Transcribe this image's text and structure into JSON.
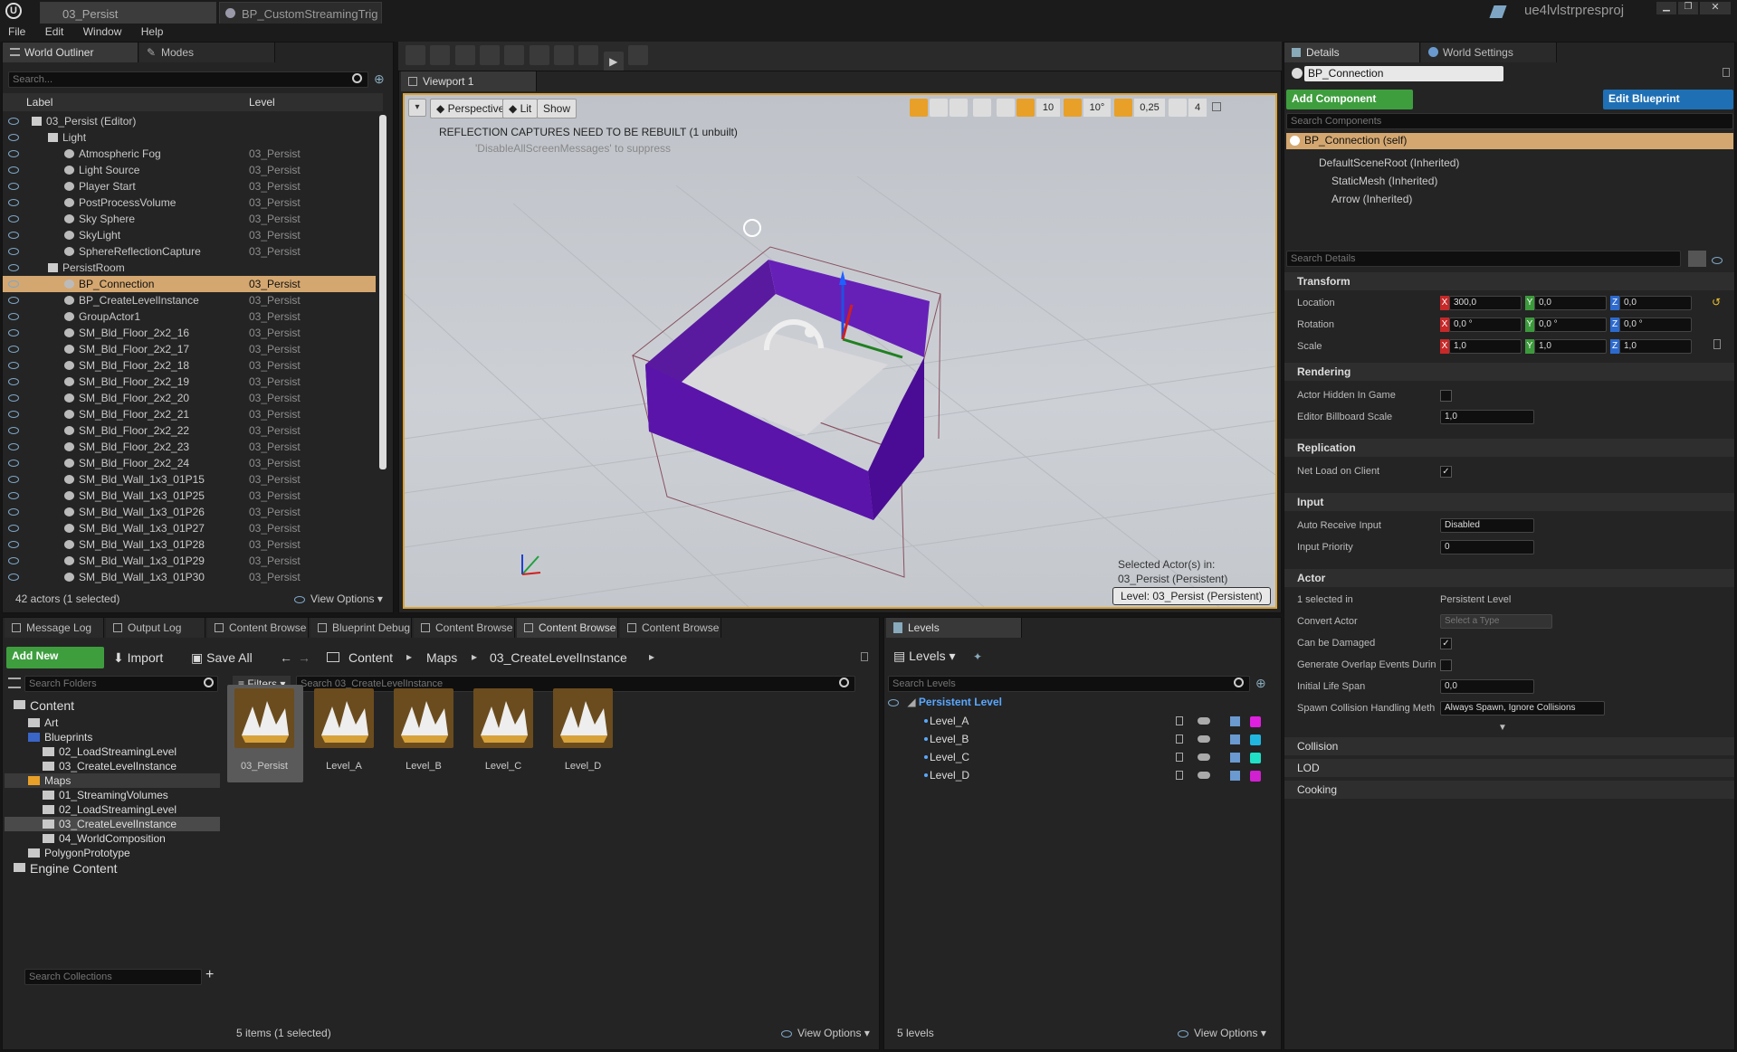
{
  "app": {
    "document_tabs": [
      "03_Persist",
      "BP_CustomStreamingTrig"
    ],
    "project": "ue4lvlstrpresproj"
  },
  "menu": [
    "File",
    "Edit",
    "Window",
    "Help"
  ],
  "outliner": {
    "tabs": [
      "World Outliner",
      "Modes"
    ],
    "search_placeholder": "Search...",
    "col_label": "Label",
    "col_level": "Level",
    "rows": [
      {
        "label": "03_Persist (Editor)",
        "level": "",
        "indent": 0
      },
      {
        "label": "Light",
        "level": "",
        "indent": 1
      },
      {
        "label": "Atmospheric Fog",
        "level": "03_Persist",
        "indent": 2
      },
      {
        "label": "Light Source",
        "level": "03_Persist",
        "indent": 2
      },
      {
        "label": "Player Start",
        "level": "03_Persist",
        "indent": 2
      },
      {
        "label": "PostProcessVolume",
        "level": "03_Persist",
        "indent": 2
      },
      {
        "label": "Sky Sphere",
        "level": "03_Persist",
        "indent": 2
      },
      {
        "label": "SkyLight",
        "level": "03_Persist",
        "indent": 2
      },
      {
        "label": "SphereReflectionCapture",
        "level": "03_Persist",
        "indent": 2
      },
      {
        "label": "PersistRoom",
        "level": "",
        "indent": 1
      },
      {
        "label": "BP_Connection",
        "level": "03_Persist",
        "indent": 2,
        "selected": true
      },
      {
        "label": "BP_CreateLevelInstance",
        "level": "03_Persist",
        "indent": 2
      },
      {
        "label": "GroupActor1",
        "level": "03_Persist",
        "indent": 2
      },
      {
        "label": "SM_Bld_Floor_2x2_16",
        "level": "03_Persist",
        "indent": 2
      },
      {
        "label": "SM_Bld_Floor_2x2_17",
        "level": "03_Persist",
        "indent": 2
      },
      {
        "label": "SM_Bld_Floor_2x2_18",
        "level": "03_Persist",
        "indent": 2
      },
      {
        "label": "SM_Bld_Floor_2x2_19",
        "level": "03_Persist",
        "indent": 2
      },
      {
        "label": "SM_Bld_Floor_2x2_20",
        "level": "03_Persist",
        "indent": 2
      },
      {
        "label": "SM_Bld_Floor_2x2_21",
        "level": "03_Persist",
        "indent": 2
      },
      {
        "label": "SM_Bld_Floor_2x2_22",
        "level": "03_Persist",
        "indent": 2
      },
      {
        "label": "SM_Bld_Floor_2x2_23",
        "level": "03_Persist",
        "indent": 2
      },
      {
        "label": "SM_Bld_Floor_2x2_24",
        "level": "03_Persist",
        "indent": 2
      },
      {
        "label": "SM_Bld_Wall_1x3_01P15",
        "level": "03_Persist",
        "indent": 2
      },
      {
        "label": "SM_Bld_Wall_1x3_01P25",
        "level": "03_Persist",
        "indent": 2
      },
      {
        "label": "SM_Bld_Wall_1x3_01P26",
        "level": "03_Persist",
        "indent": 2
      },
      {
        "label": "SM_Bld_Wall_1x3_01P27",
        "level": "03_Persist",
        "indent": 2
      },
      {
        "label": "SM_Bld_Wall_1x3_01P28",
        "level": "03_Persist",
        "indent": 2
      },
      {
        "label": "SM_Bld_Wall_1x3_01P29",
        "level": "03_Persist",
        "indent": 2
      },
      {
        "label": "SM_Bld_Wall_1x3_01P30",
        "level": "03_Persist",
        "indent": 2
      }
    ],
    "status": "42 actors (1 selected)",
    "view_options": "View Options"
  },
  "viewport": {
    "tab": "Viewport 1",
    "perspective": "Perspective",
    "lit": "Lit",
    "show": "Show",
    "grid_snap": "10",
    "rot_snap": "10°",
    "scale_snap": "0,25",
    "cam_speed": "4",
    "warning": "REFLECTION CAPTURES NEED TO BE REBUILT (1 unbuilt)",
    "suppress": "'DisableAllScreenMessages' to suppress",
    "selected_line1": "Selected Actor(s) in:",
    "selected_line2": "03_Persist (Persistent)",
    "level_badge": "Level:  03_Persist (Persistent)"
  },
  "bottom_tabs": [
    "Message Log",
    "Output Log",
    "Content Browse",
    "Blueprint Debug",
    "Content Browse",
    "Content Browse",
    "Content Browse"
  ],
  "content": {
    "add_new": "Add New",
    "import": "Import",
    "save_all": "Save All",
    "path": [
      "Content",
      "Maps",
      "03_CreateLevelInstance"
    ],
    "search_folders": "Search Folders",
    "filters": "Filters",
    "search_assets": "Search 03_CreateLevelInstance",
    "tree": [
      {
        "label": "Content",
        "indent": 0,
        "big": true
      },
      {
        "label": "Art",
        "indent": 1
      },
      {
        "label": "Blueprints",
        "indent": 1
      },
      {
        "label": "02_LoadStreamingLevel",
        "indent": 2
      },
      {
        "label": "03_CreateLevelInstance",
        "indent": 2
      },
      {
        "label": "Maps",
        "indent": 1,
        "highlight": true
      },
      {
        "label": "01_StreamingVolumes",
        "indent": 2
      },
      {
        "label": "02_LoadStreamingLevel",
        "indent": 2
      },
      {
        "label": "03_CreateLevelInstance",
        "indent": 2,
        "selected": true
      },
      {
        "label": "04_WorldComposition",
        "indent": 2
      },
      {
        "label": "PolygonPrototype",
        "indent": 1
      },
      {
        "label": "Engine Content",
        "indent": 0,
        "big": true
      }
    ],
    "assets": [
      "03_Persist",
      "Level_A",
      "Level_B",
      "Level_C",
      "Level_D"
    ],
    "search_collections": "Search Collections",
    "status": "5 items (1 selected)",
    "view_options": "View Options"
  },
  "levels": {
    "tab": "Levels",
    "menu": "Levels",
    "search_placeholder": "Search Levels",
    "persistent": "Persistent Level",
    "items": [
      {
        "name": "Level_A",
        "color": "#e020e0"
      },
      {
        "name": "Level_B",
        "color": "#20b8e0"
      },
      {
        "name": "Level_C",
        "color": "#20e0c8"
      },
      {
        "name": "Level_D",
        "color": "#d020d0"
      }
    ],
    "status": "5 levels",
    "view_options": "View Options"
  },
  "details": {
    "tabs": [
      "Details",
      "World Settings"
    ],
    "name": "BP_Connection",
    "add_component": "Add Component",
    "edit_blueprint": "Edit Blueprint",
    "search_components": "Search Components",
    "self": "BP_Connection (self)",
    "components": [
      "DefaultSceneRoot (Inherited)",
      "StaticMesh (Inherited)",
      "Arrow (Inherited)"
    ],
    "search_details": "Search Details",
    "transform": {
      "title": "Transform",
      "location": "Location",
      "rotation": "Rotation",
      "scale": "Scale",
      "loc": [
        "300,0",
        "0,0",
        "0,0"
      ],
      "rot": [
        "0,0 °",
        "0,0 °",
        "0,0 °"
      ],
      "scl": [
        "1,0",
        "1,0",
        "1,0"
      ]
    },
    "rendering": {
      "title": "Rendering",
      "hidden": "Actor Hidden In Game",
      "billboard": "Editor Billboard Scale",
      "billboard_val": "1,0"
    },
    "replication": {
      "title": "Replication",
      "net_load": "Net Load on Client"
    },
    "input": {
      "title": "Input",
      "auto": "Auto Receive Input",
      "auto_val": "Disabled",
      "priority": "Input Priority",
      "priority_val": "0"
    },
    "actor": {
      "title": "Actor",
      "selected_in": "1 selected in",
      "selected_in_val": "Persistent Level",
      "convert": "Convert Actor",
      "convert_val": "Select a Type",
      "damaged": "Can be Damaged",
      "overlap": "Generate Overlap Events Durin",
      "life": "Initial Life Span",
      "life_val": "0,0",
      "spawn": "Spawn Collision Handling Meth",
      "spawn_val": "Always Spawn, Ignore Collisions"
    },
    "collapsed": [
      "Collision",
      "LOD",
      "Cooking"
    ]
  }
}
